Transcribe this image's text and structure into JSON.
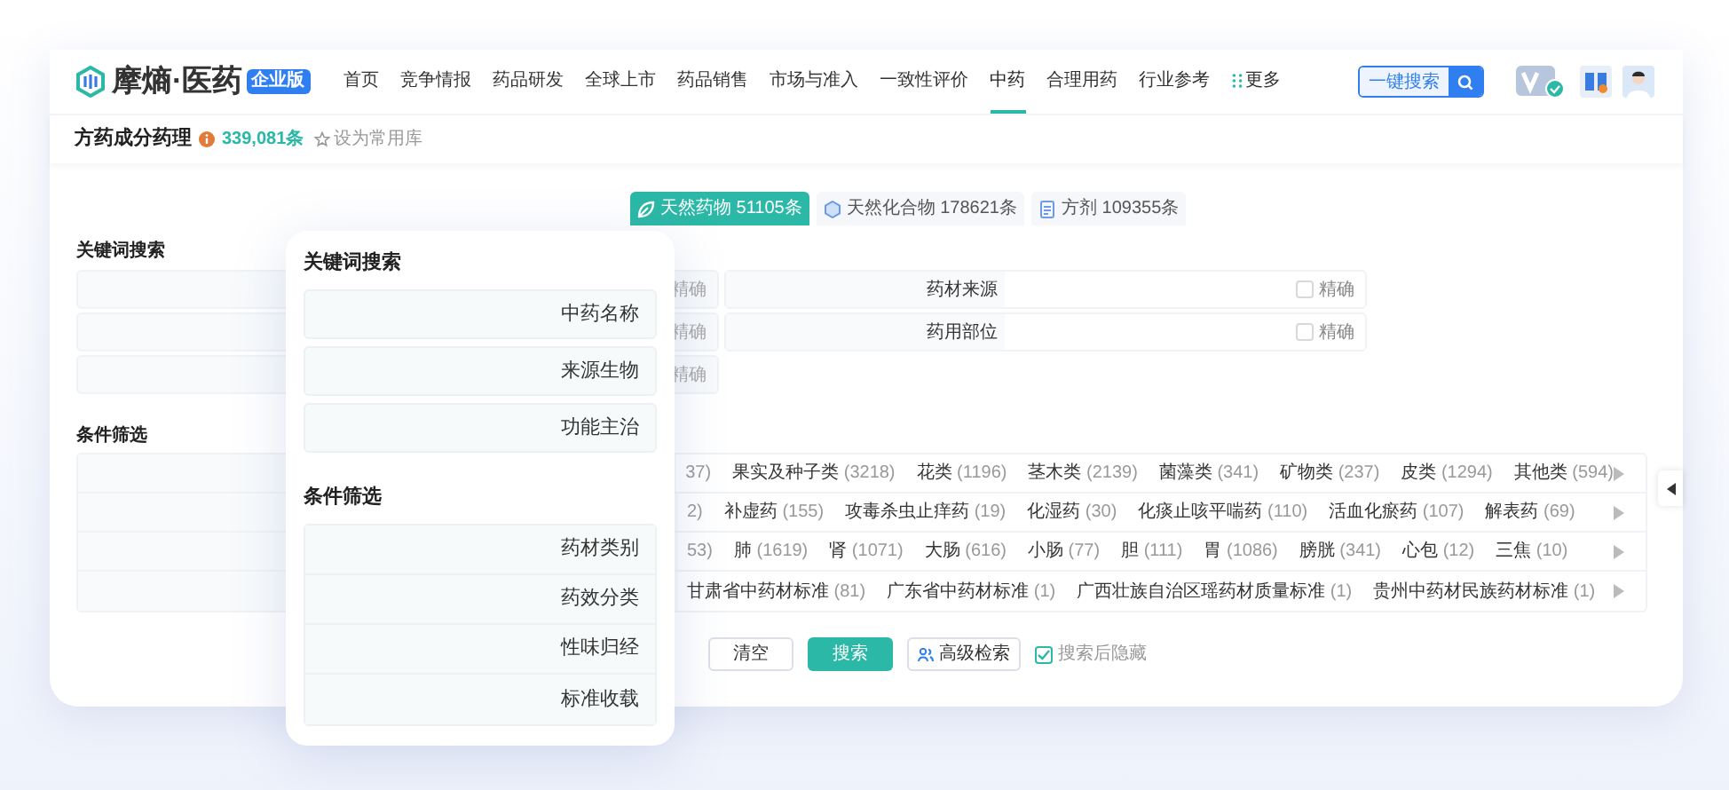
{
  "brand": {
    "name": "摩熵·医药",
    "badge": "企业版"
  },
  "nav": [
    {
      "label": "首页",
      "selected": false
    },
    {
      "label": "竞争情报",
      "selected": false
    },
    {
      "label": "药品研发",
      "selected": false
    },
    {
      "label": "全球上市",
      "selected": false
    },
    {
      "label": "药品销售",
      "selected": false
    },
    {
      "label": "市场与准入",
      "selected": false
    },
    {
      "label": "一致性评价",
      "selected": false
    },
    {
      "label": "中药",
      "selected": true
    },
    {
      "label": "合理用药",
      "selected": false
    },
    {
      "label": "行业参考",
      "selected": false
    },
    {
      "label": "更多",
      "selected": false
    }
  ],
  "header_search": {
    "label": "一键搜索"
  },
  "page": {
    "title": "方药成分药理",
    "count": "339,081条",
    "favorite": "设为常用库"
  },
  "dataset_tabs": [
    {
      "label": "天然药物 51105条",
      "selected": true,
      "kind": "herb"
    },
    {
      "label": "天然化合物 178621条",
      "selected": false,
      "kind": "compound"
    },
    {
      "label": "方剂 109355条",
      "selected": false,
      "kind": "formula"
    }
  ],
  "keyword_section": {
    "title": "关键词搜索",
    "rows": [
      {
        "exact": "精确",
        "field": {
          "label": "药材来源",
          "exact": "精确",
          "checked": false
        }
      },
      {
        "exact": "精确",
        "field": {
          "label": "药用部位",
          "exact": "精确",
          "checked": false
        }
      },
      {
        "exact": "精确"
      }
    ]
  },
  "filter_section": {
    "title": "条件筛选",
    "rows": [
      {
        "options": [
          {
            "count": "37)"
          },
          {
            "name": "果实及种子类",
            "count": "(3218)"
          },
          {
            "name": "花类",
            "count": "(1196)"
          },
          {
            "name": "茎木类",
            "count": "(2139)"
          },
          {
            "name": "菌藻类",
            "count": "(341)"
          },
          {
            "name": "矿物类",
            "count": "(237)"
          },
          {
            "name": "皮类",
            "count": "(1294)"
          },
          {
            "name": "其他类",
            "count": "(594)"
          }
        ]
      },
      {
        "options": [
          {
            "count": "2)"
          },
          {
            "name": "补虚药",
            "count": "(155)"
          },
          {
            "name": "攻毒杀虫止痒药",
            "count": "(19)"
          },
          {
            "name": "化湿药",
            "count": "(30)"
          },
          {
            "name": "化痰止咳平喘药",
            "count": "(110)"
          },
          {
            "name": "活血化瘀药",
            "count": "(107)"
          },
          {
            "name": "解表药",
            "count": "(69)"
          }
        ]
      },
      {
        "options": [
          {
            "count": "53)"
          },
          {
            "name": "肺",
            "count": "(1619)"
          },
          {
            "name": "肾",
            "count": "(1071)"
          },
          {
            "name": "大肠",
            "count": "(616)"
          },
          {
            "name": "小肠",
            "count": "(77)"
          },
          {
            "name": "胆",
            "count": "(111)"
          },
          {
            "name": "胃",
            "count": "(1086)"
          },
          {
            "name": "膀胱",
            "count": "(341)"
          },
          {
            "name": "心包",
            "count": "(12)"
          },
          {
            "name": "三焦",
            "count": "(10)"
          }
        ]
      },
      {
        "options": [
          {
            "name": "甘肃省中药材标准",
            "count": "(81)"
          },
          {
            "name": "广东省中药材标准",
            "count": "(1)"
          },
          {
            "name": "广西壮族自治区瑶药材质量标准",
            "count": "(1)"
          },
          {
            "name": "贵州中药材民族药材标准",
            "count": "(1)"
          }
        ]
      }
    ]
  },
  "actions": {
    "clear": "清空",
    "search": "搜索",
    "advanced": "高级检索",
    "hide_after_search": {
      "label": "搜索后隐藏",
      "checked": true
    }
  },
  "popup": {
    "sections": [
      {
        "title": "关键词搜索",
        "items": [
          "中药名称",
          "来源生物",
          "功能主治"
        ]
      },
      {
        "title": "条件筛选",
        "items": [
          "药材类别",
          "药效分类",
          "性味归经",
          "标准收载"
        ]
      }
    ]
  }
}
